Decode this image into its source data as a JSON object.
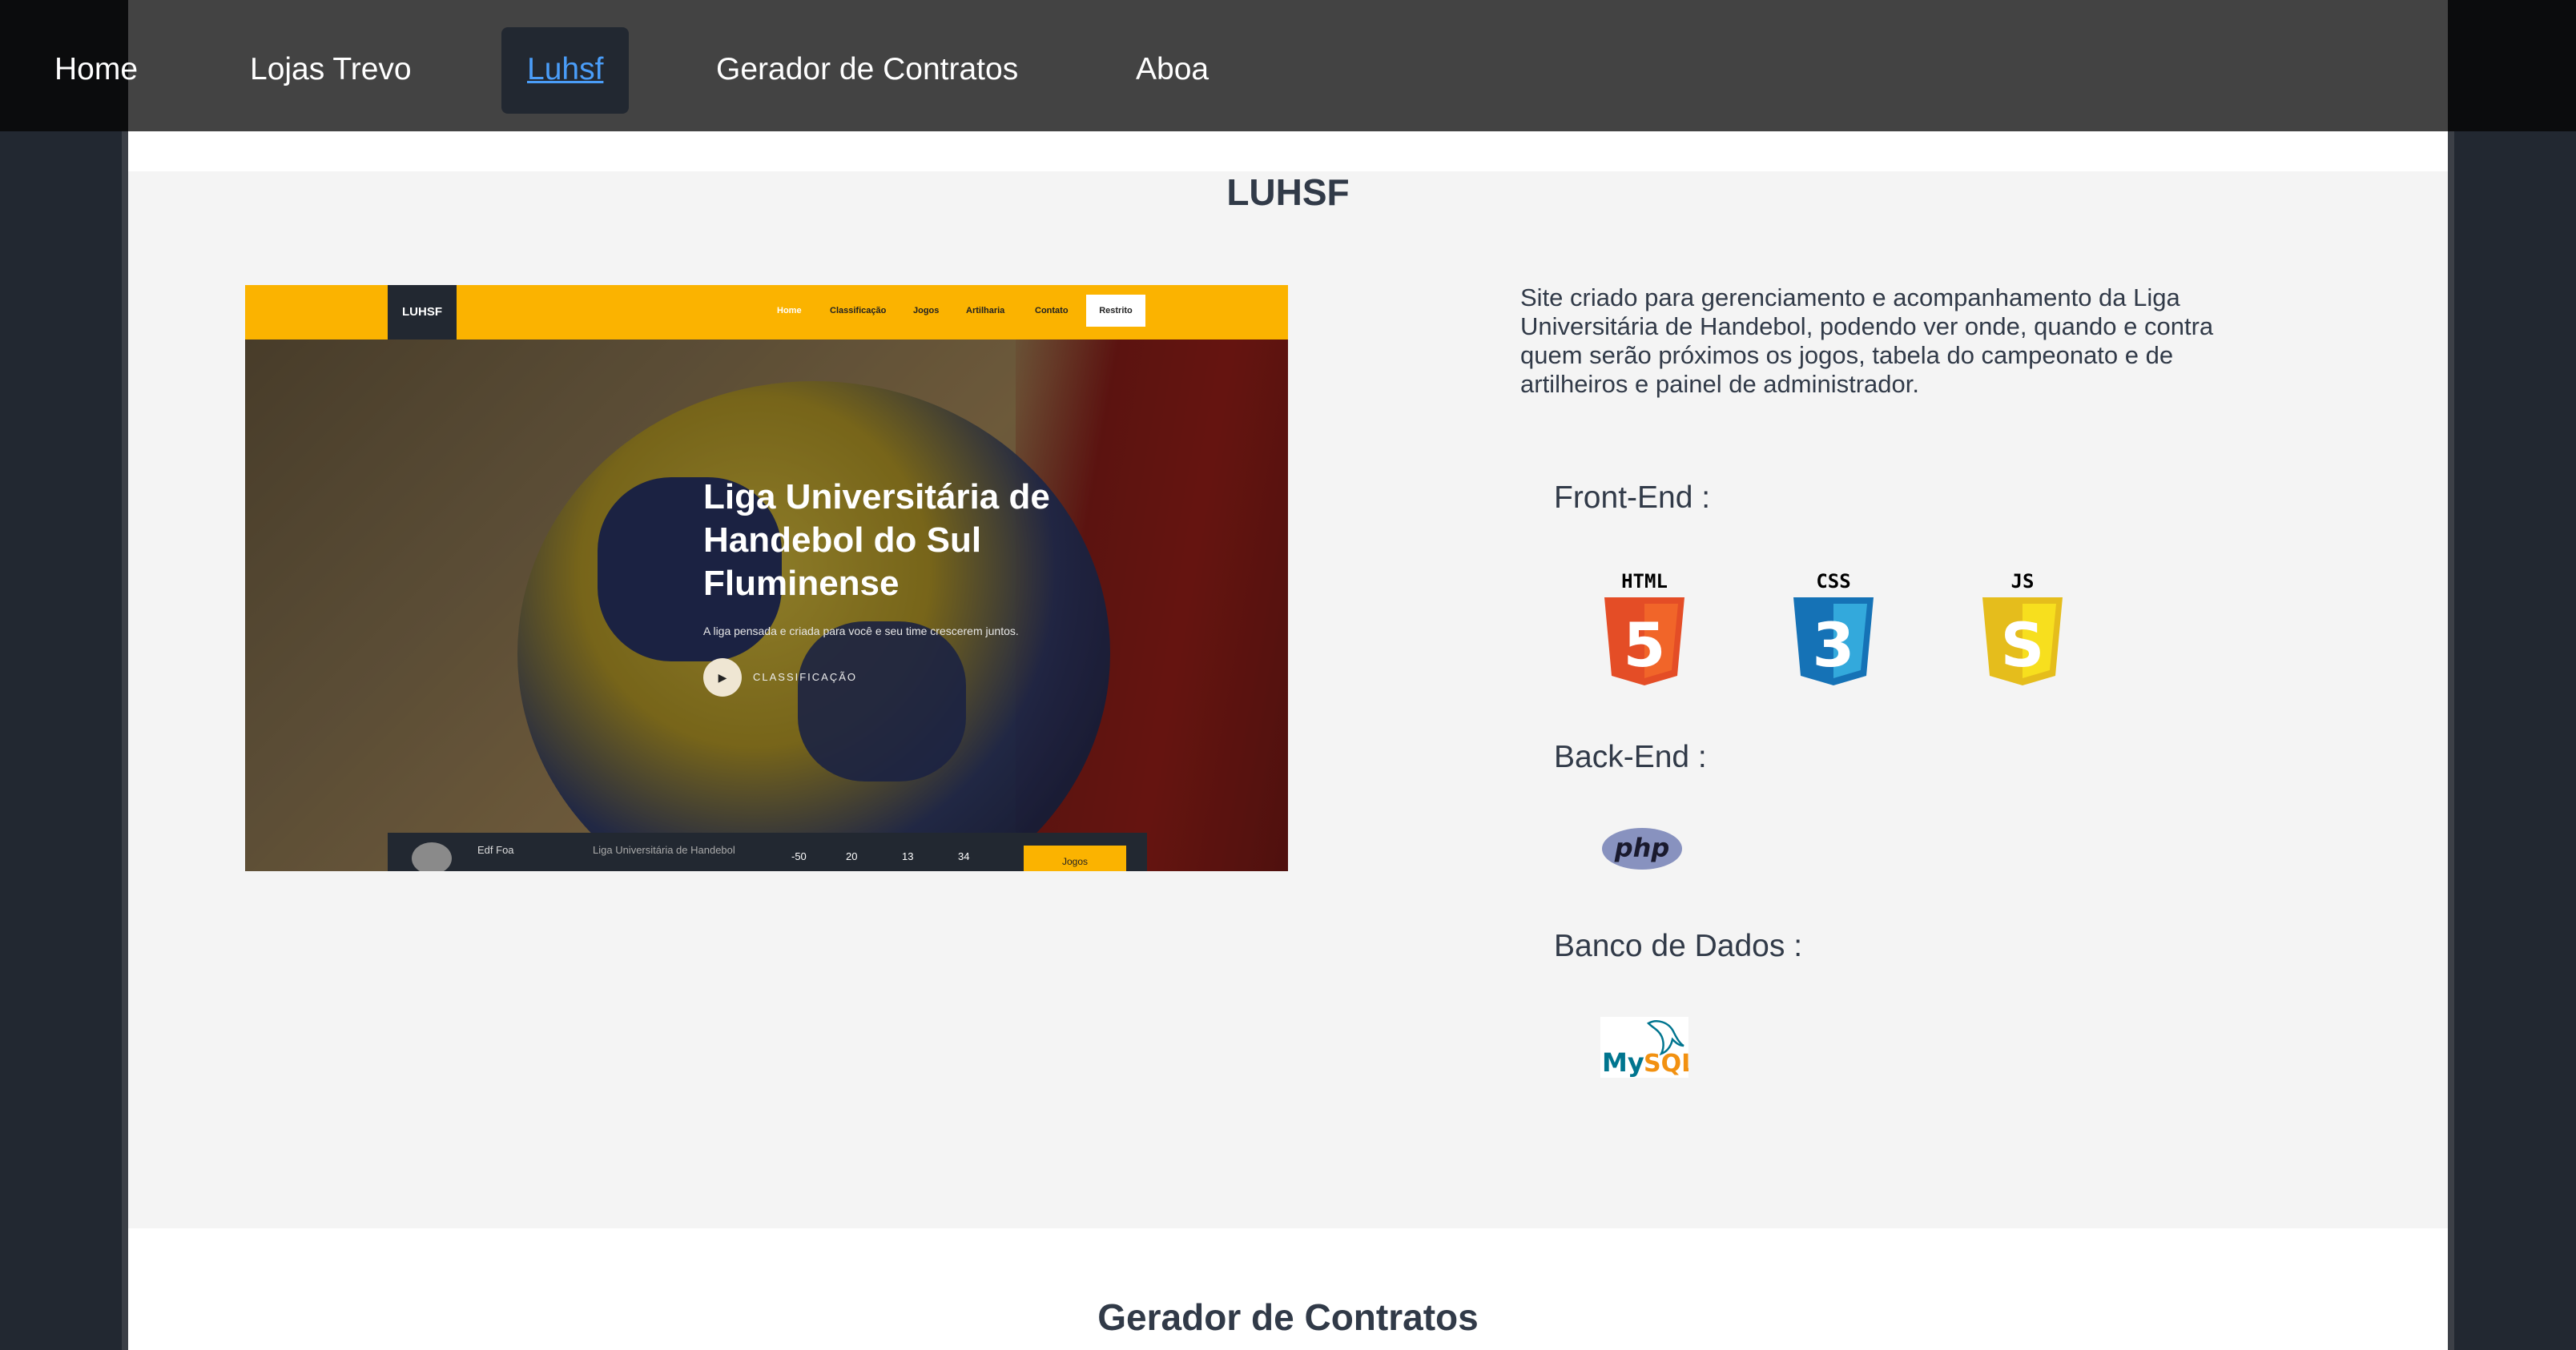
{
  "nav": {
    "items": [
      {
        "label": "Home"
      },
      {
        "label": "Lojas Trevo"
      },
      {
        "label": "Luhsf"
      },
      {
        "label": "Gerador de Contratos"
      },
      {
        "label": "Aboa"
      }
    ],
    "active_index": 2
  },
  "project": {
    "title": "LUHSF",
    "description": "Site criado para gerenciamento e acompanhamento da Liga Universitária de Handebol, podendo ver onde, quando e contra quem serão próximos os jogos, tabela do campeonato e de artilheiros e painel de administrador.",
    "screenshot": {
      "logo": "LUHSF",
      "menu": [
        "Home",
        "Classificação",
        "Jogos",
        "Artilharia",
        "Contato"
      ],
      "restricted_button": "Restrito",
      "hero_title": "Liga Universitária de Handebol do Sul Fluminense",
      "hero_subtitle": "A liga pensada e criada para você e seu time crescerem juntos.",
      "cta_label": "CLASSIFICAÇÃO",
      "bottom_bar": {
        "team": "Edf Foa",
        "league": "Liga Universitária de Handebol",
        "stats": [
          "-50",
          "20",
          "13",
          "34"
        ],
        "button": "Jogos"
      }
    },
    "front_end_label": "Front-End :",
    "back_end_label": "Back-End :",
    "database_label": "Banco de Dados :",
    "front_end_icons": [
      {
        "name": "html5-icon",
        "label": "HTML",
        "digit": "5",
        "color": "#e44d26",
        "shade": "#f16529"
      },
      {
        "name": "css3-icon",
        "label": "CSS",
        "digit": "3",
        "color": "#1572b6",
        "shade": "#33a9dc"
      },
      {
        "name": "js-icon",
        "label": "JS",
        "digit": "S",
        "color": "#e5bd1c",
        "shade": "#f7df1e"
      }
    ],
    "back_end_icons": [
      {
        "name": "php-icon",
        "label": "php",
        "color": "#8892bf"
      }
    ],
    "database_icons": [
      {
        "name": "mysql-icon",
        "label_blue": "My",
        "label_orange": "SQL",
        "color_blue": "#00758f",
        "color_orange": "#f29111"
      }
    ]
  },
  "next_section": {
    "title": "Gerador de Contratos"
  }
}
